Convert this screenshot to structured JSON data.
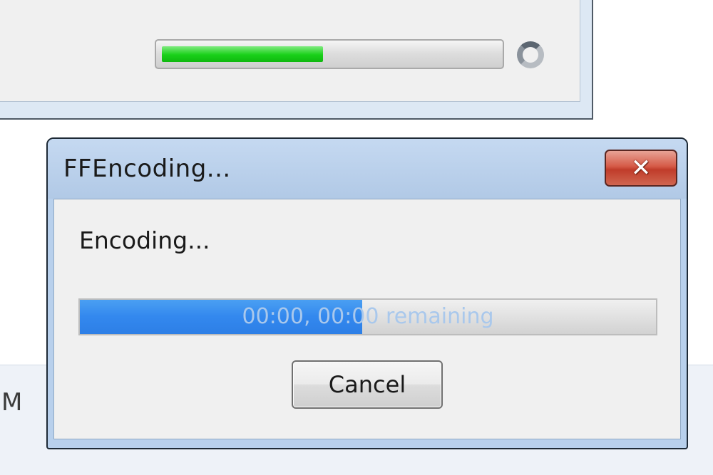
{
  "background_window": {
    "progress": 0.48,
    "lower_text": "M",
    "colors": {
      "progress_fill": "#19d019"
    }
  },
  "dialog": {
    "title": "FFEncoding...",
    "close_icon": "close-icon",
    "status_label": "Encoding...",
    "progress": {
      "value": 0.49,
      "text": "00:00, 00:00 remaining"
    },
    "cancel_label": "Cancel",
    "colors": {
      "progress_fill": "#3388ee",
      "close_button": "#c03c2a"
    }
  }
}
